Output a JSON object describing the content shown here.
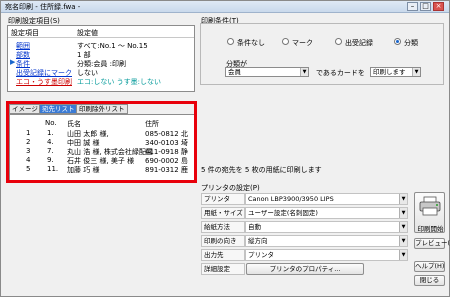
{
  "window": {
    "title": "宛名印刷 - 住所録.fwa -",
    "min": "–",
    "max": "□",
    "close": "×"
  },
  "settings": {
    "group_label": "印刷設定項目(S)",
    "col_item": "設定項目",
    "col_value": "設定値",
    "rows": [
      {
        "item": "範囲",
        "value": "すべて:No.1 ～ No.15",
        "style": "link"
      },
      {
        "item": "部数",
        "value": "1 部",
        "style": "link"
      },
      {
        "item": "条件",
        "value": "分類:会員 :印刷",
        "style": "selected"
      },
      {
        "item": "出受記録にマーク",
        "value": "しない",
        "style": "link"
      },
      {
        "item": "エコ・うす墨印刷",
        "value": "エコ:しない うす墨:しない",
        "style": "red"
      }
    ]
  },
  "tabs": [
    "イメージ",
    "宛先リスト",
    "印刷除外リスト"
  ],
  "list": {
    "headers": {
      "no": "No.",
      "name": "氏名",
      "address": "住所"
    },
    "rows": [
      {
        "idx": "1",
        "no": "1.",
        "name": "山田 太郎 様,",
        "address": "085-0812 北"
      },
      {
        "idx": "2",
        "no": "4.",
        "name": "中田 誠 様",
        "address": "340-0103 埼"
      },
      {
        "idx": "3",
        "no": "7.",
        "name": "丸山 浩 様, 株式会社緑配園",
        "address": "411-0918 静"
      },
      {
        "idx": "4",
        "no": "9.",
        "name": "石井 俊三 様, 美子 様",
        "address": "690-0002 島"
      },
      {
        "idx": "5",
        "no": "11.",
        "name": "加藤 巧 様",
        "address": "891-0312 鹿"
      }
    ]
  },
  "conditions": {
    "group_label": "印刷条件(T)",
    "options": [
      "条件なし",
      "マーク",
      "出受記録",
      "分類"
    ],
    "selected": "分類",
    "category_label": "分類が",
    "category_value": "会員",
    "card_label": "であるカードを",
    "action_value": "印刷します"
  },
  "summary": "5 件の宛先を 5 枚の用紙に印刷します",
  "printer": {
    "group_label": "プリンタの設定(P)",
    "rows": [
      {
        "label": "プリンタ",
        "value": "Canon LBP3900/3950 LIPS"
      },
      {
        "label": "用紙・サイズ",
        "value": "ユーザー設定(名刺固定)"
      },
      {
        "label": "給紙方法",
        "value": "自動"
      },
      {
        "label": "印刷の向き",
        "value": "縦方向"
      },
      {
        "label": "出力先",
        "value": "プリンタ"
      }
    ],
    "detail_label": "詳細設定",
    "properties_button": "プリンタのプロパティ..."
  },
  "buttons": {
    "print": "印刷開始",
    "preview": "プレビュー(V)",
    "help": "ヘルプ(H)",
    "close": "閉じる"
  },
  "colors": {
    "highlight_border": "#e8000b",
    "link": "#0033cc",
    "red_text": "#cc0000"
  }
}
